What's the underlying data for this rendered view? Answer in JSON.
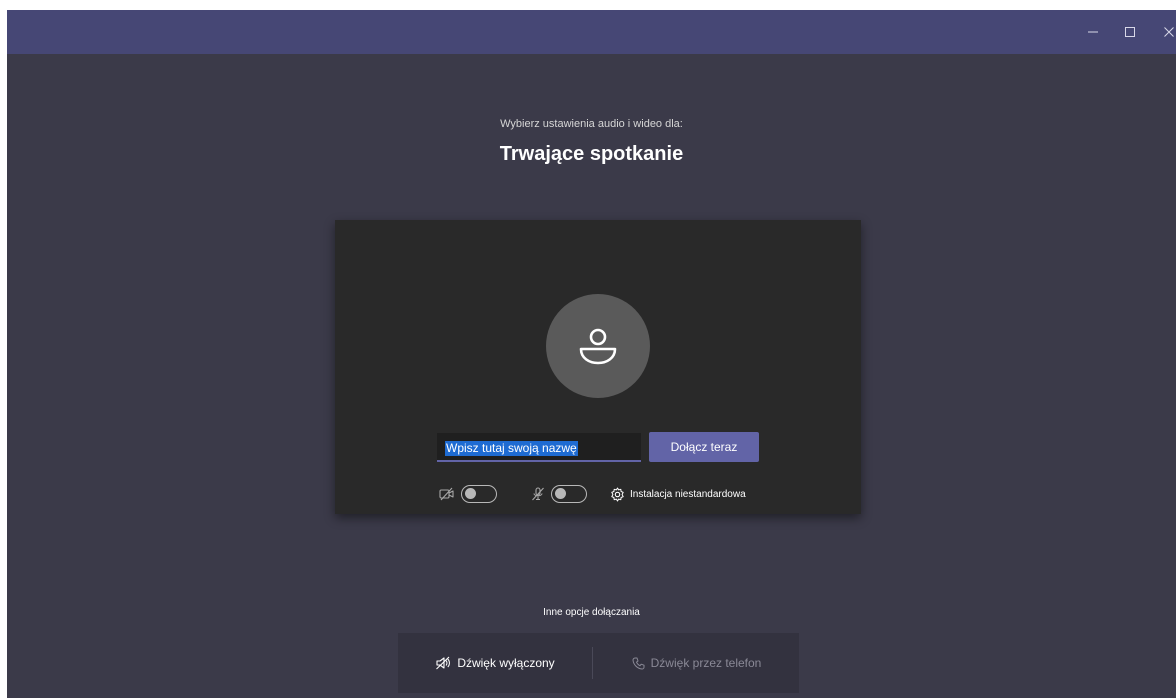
{
  "window": {
    "controls": [
      "minimize-icon",
      "maximize-icon",
      "close-icon"
    ]
  },
  "header": {
    "subtitle": "Wybierz ustawienia audio i wideo dla:",
    "title": "Trwające spotkanie"
  },
  "preview": {
    "avatar_icon": "person-icon",
    "name_placeholder": "Wpisz tutaj swoją nazwę",
    "join_label": "Dołącz teraz",
    "camera": {
      "icon": "camera-off-icon",
      "on": false
    },
    "microphone": {
      "icon": "mic-off-icon",
      "on": false
    },
    "settings": {
      "icon": "gear-icon",
      "label": "Instalacja niestandardowa"
    }
  },
  "other_options": {
    "label": "Inne opcje dołączania",
    "audio_off": {
      "icon": "speaker-off-icon",
      "label": "Dźwięk wyłączony"
    },
    "phone_audio": {
      "icon": "phone-icon",
      "label": "Dźwięk przez telefon"
    }
  },
  "colors": {
    "titlebar": "#464775",
    "background": "#3b3a49",
    "accent": "#6264a7",
    "preview_bg": "#292929",
    "selection": "#1e6bd2"
  }
}
